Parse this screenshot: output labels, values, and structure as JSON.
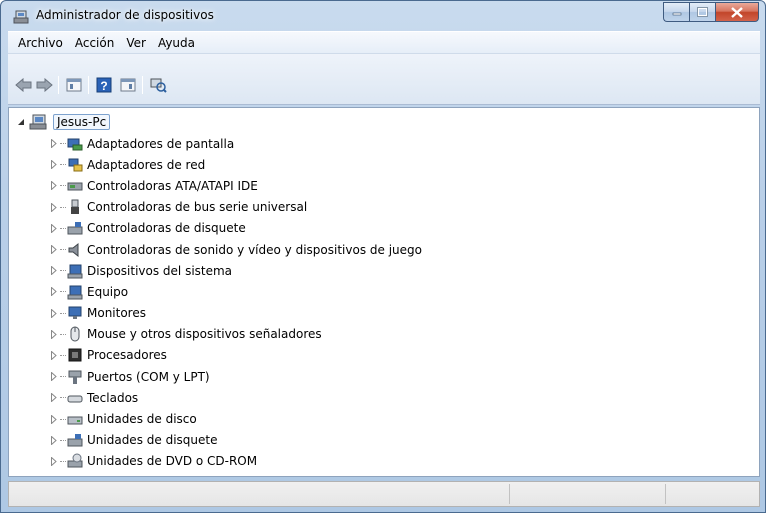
{
  "window": {
    "title": "Administrador de dispositivos"
  },
  "menu": [
    "Archivo",
    "Acción",
    "Ver",
    "Ayuda"
  ],
  "toolbar": [
    "back-icon",
    "forward-icon",
    "properties-icon",
    "help-icon",
    "update-driver-icon",
    "scan-hardware-icon"
  ],
  "tree": {
    "root": "Jesus-Pc",
    "items": [
      {
        "label": "Adaptadores de pantalla",
        "icon": "display-adapter-icon"
      },
      {
        "label": "Adaptadores de red",
        "icon": "network-adapter-icon"
      },
      {
        "label": "Controladoras ATA/ATAPI IDE",
        "icon": "ide-controller-icon"
      },
      {
        "label": "Controladoras de bus serie universal",
        "icon": "usb-icon"
      },
      {
        "label": "Controladoras de disquete",
        "icon": "floppy-controller-icon"
      },
      {
        "label": "Controladoras de sonido y vídeo y dispositivos de juego",
        "icon": "sound-icon"
      },
      {
        "label": "Dispositivos del sistema",
        "icon": "system-device-icon"
      },
      {
        "label": "Equipo",
        "icon": "computer-icon"
      },
      {
        "label": "Monitores",
        "icon": "monitor-icon"
      },
      {
        "label": "Mouse y otros dispositivos señaladores",
        "icon": "mouse-icon"
      },
      {
        "label": "Procesadores",
        "icon": "processor-icon"
      },
      {
        "label": "Puertos (COM y LPT)",
        "icon": "port-icon"
      },
      {
        "label": "Teclados",
        "icon": "keyboard-icon"
      },
      {
        "label": "Unidades de disco",
        "icon": "disk-drive-icon"
      },
      {
        "label": "Unidades de disquete",
        "icon": "floppy-drive-icon"
      },
      {
        "label": "Unidades de DVD o CD-ROM",
        "icon": "dvd-drive-icon"
      }
    ]
  }
}
